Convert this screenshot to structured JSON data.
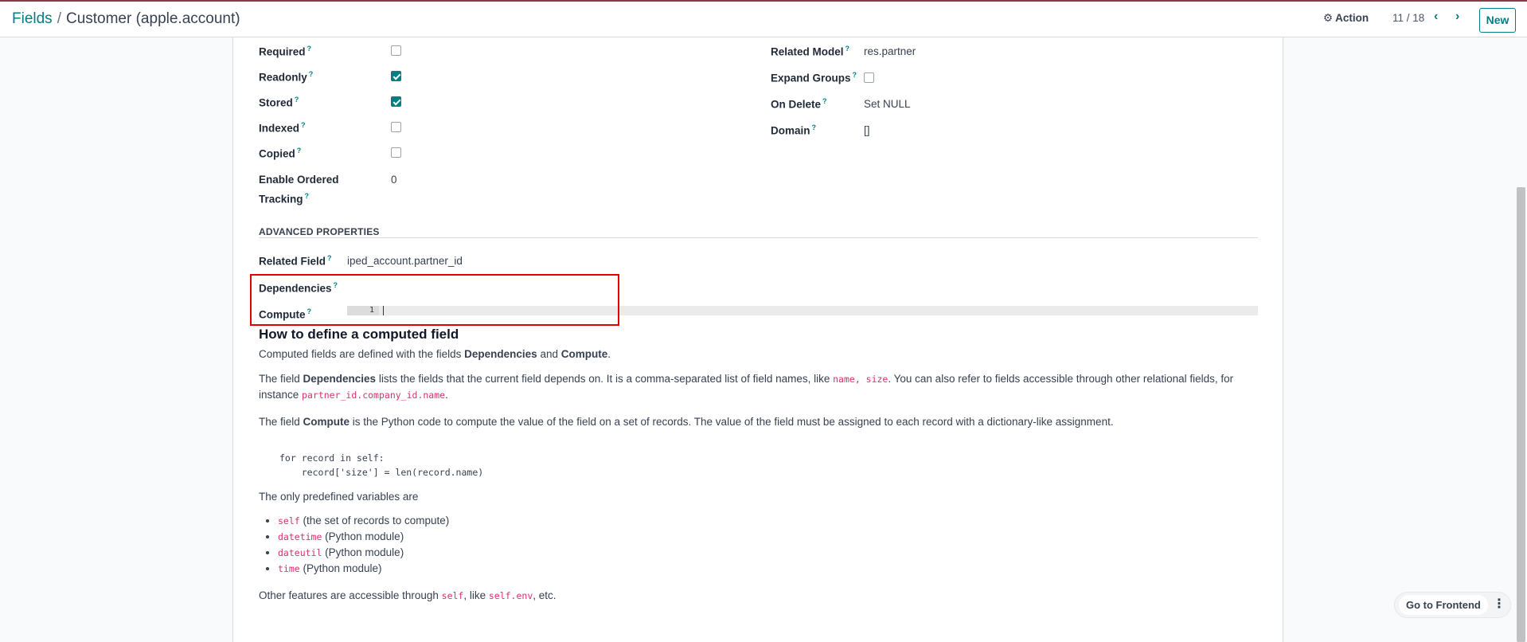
{
  "header": {
    "breadcrumb_parent": "Fields",
    "breadcrumb_separator": "/",
    "breadcrumb_current": "Customer (apple.account)",
    "action_label": "Action",
    "pager_value": "11 / 18",
    "new_label": "New"
  },
  "left_fields": [
    {
      "label": "Required",
      "checked": false
    },
    {
      "label": "Readonly",
      "checked": true
    },
    {
      "label": "Stored",
      "checked": true
    },
    {
      "label": "Indexed",
      "checked": false
    },
    {
      "label": "Copied",
      "checked": false
    }
  ],
  "ordered_tracking": {
    "label_line1": "Enable Ordered",
    "label_line2": "Tracking",
    "value": "0"
  },
  "right_fields": {
    "related_model_label": "Related Model",
    "related_model_value": "res.partner",
    "expand_groups_label": "Expand Groups",
    "expand_groups_checked": false,
    "on_delete_label": "On Delete",
    "on_delete_value": "Set NULL",
    "domain_label": "Domain",
    "domain_value": "[]"
  },
  "advanced": {
    "section_title": "ADVANCED PROPERTIES",
    "related_field_label": "Related Field",
    "related_field_value": "iped_account.partner_id",
    "dependencies_label": "Dependencies",
    "compute_label": "Compute",
    "editor_line_number": "1"
  },
  "help": {
    "title": "How to define a computed field",
    "p1": {
      "before": "Computed fields are defined with the fields ",
      "b1": "Dependencies",
      "mid": " and ",
      "b2": "Compute",
      "after": "."
    },
    "p2": {
      "before": "The field ",
      "b1": "Dependencies",
      "mid": " lists the fields that the current field depends on. It is a comma-separated list of field names, like ",
      "code1": "name, size",
      "mid2": ". You can also refer to fields accessible through other relational fields, for instance ",
      "code2": "partner_id.company_id.name",
      "after": "."
    },
    "p3": {
      "before": "The field ",
      "b1": "Compute",
      "after": " is the Python code to compute the value of the field on a set of records. The value of the field must be assigned to each record with a dictionary-like assignment."
    },
    "code_line1": "for record in self:",
    "code_line2": "    record['size'] = len(record.name)",
    "p4": "The only predefined variables are",
    "bullets": [
      {
        "code": "self",
        "text": " (the set of records to compute)"
      },
      {
        "code": "datetime",
        "text": " (Python module)"
      },
      {
        "code": "dateutil",
        "text": " (Python module)"
      },
      {
        "code": "time",
        "text": " (Python module)"
      }
    ],
    "p5": {
      "before": "Other features are accessible through ",
      "code1": "self",
      "mid": ", like ",
      "code2": "self.env",
      "after": ", etc."
    }
  },
  "footer": {
    "go_frontend_label": "Go to Frontend",
    "more_icon": "⋮"
  },
  "icons": {
    "gear": "⚙",
    "prev": "‹",
    "next": "›",
    "help_mark": "?"
  },
  "colors": {
    "brand": "#017e84",
    "accent_top": "#8b3a4c",
    "highlight": "#e00000",
    "code": "#d6336c"
  }
}
